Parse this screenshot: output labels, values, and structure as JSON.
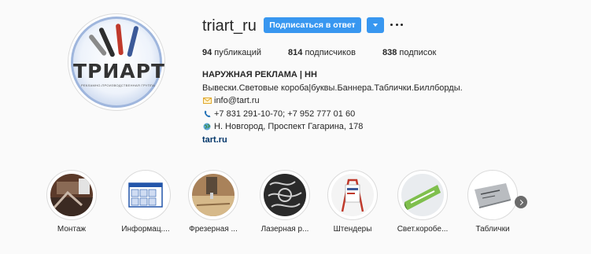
{
  "profile": {
    "username": "triart_ru",
    "follow_button": "Подписаться в ответ",
    "avatar": {
      "logo_text": "ТРИАРТ",
      "logo_subtext": "РЕКЛАМНО-ПРОИЗВОДСТВЕННАЯ ГРУППА"
    },
    "stats": {
      "posts_count": "94",
      "posts_label": " публикаций",
      "followers_count": "814",
      "followers_label": " подписчиков",
      "following_count": "838",
      "following_label": " подписок"
    },
    "bio": {
      "title": "НАРУЖНАЯ РЕКЛАМА | НН",
      "description": "Вывески.Световые короба|буквы.Баннера.Таблички.Биллборды.",
      "email": "info@tart.ru",
      "phone": "+7 831 291-10-70; +7 952 777 01 60",
      "address": "Н. Новгород, Проспект Гагарина, 178",
      "link": "tart.ru"
    }
  },
  "highlights": [
    {
      "label": "Монтаж",
      "icon": "montage-thumb"
    },
    {
      "label": "Информац....",
      "icon": "info-board-thumb"
    },
    {
      "label": "Фрезерная ...",
      "icon": "milling-thumb"
    },
    {
      "label": "Лазерная р...",
      "icon": "laser-thumb"
    },
    {
      "label": "Штендеры",
      "icon": "stand-thumb"
    },
    {
      "label": "Свет.коробе...",
      "icon": "lightbox-thumb"
    },
    {
      "label": "Таблички",
      "icon": "plates-thumb"
    }
  ],
  "icons": {
    "email": "envelope-icon",
    "phone": "phone-icon",
    "address": "globe-icon",
    "more": "ellipsis-icon",
    "next": "chevron-right-icon"
  },
  "colors": {
    "accent": "#3897f0",
    "link": "#003569",
    "background": "#fafafa"
  }
}
